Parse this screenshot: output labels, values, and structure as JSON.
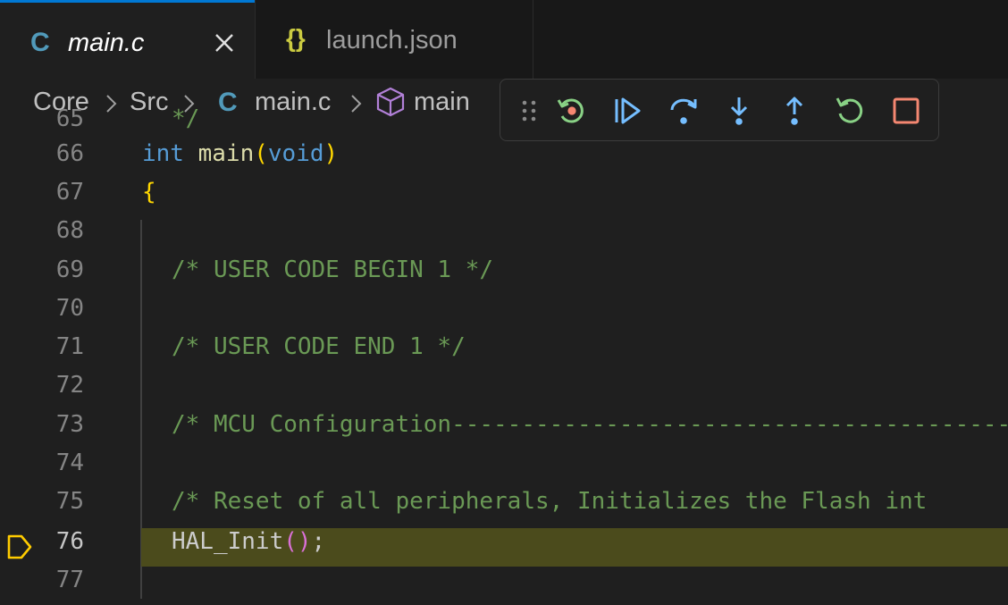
{
  "tabs": [
    {
      "label": "main.c",
      "icon": "c-file-icon",
      "active": true
    },
    {
      "label": "launch.json",
      "icon": "json-file-icon",
      "active": false
    }
  ],
  "breadcrumb": {
    "items": [
      "Core",
      "Src",
      "main.c",
      "main"
    ],
    "c_glyph": "C",
    "json_glyph": "{}"
  },
  "debug_toolbar": {
    "buttons": [
      "drag-handle",
      "restart-frame",
      "continue",
      "step-over",
      "step-into",
      "step-out",
      "restart",
      "stop"
    ]
  },
  "colors": {
    "accent": "#0078d4",
    "highlight_line": "#4b4b1c",
    "breakpoint_arrow": "#ffcc00"
  },
  "editor": {
    "partial_top_line_number": "65",
    "partial_top_text": "*/",
    "lines": [
      {
        "num": "66",
        "text": "int main(void)"
      },
      {
        "num": "67",
        "text": "{"
      },
      {
        "num": "68",
        "text": ""
      },
      {
        "num": "69",
        "text": "/* USER CODE BEGIN 1 */"
      },
      {
        "num": "70",
        "text": ""
      },
      {
        "num": "71",
        "text": "/* USER CODE END 1 */"
      },
      {
        "num": "72",
        "text": ""
      },
      {
        "num": "73",
        "text": "/* MCU Configuration----------------------------------------"
      },
      {
        "num": "74",
        "text": ""
      },
      {
        "num": "75",
        "text": "/* Reset of all peripherals, Initializes the Flash int"
      },
      {
        "num": "76",
        "text": "HAL_Init();",
        "current": true
      },
      {
        "num": "77",
        "text": ""
      }
    ],
    "tokens": {
      "kw_int": "int",
      "fn_main": "main",
      "paren_open": "(",
      "kw_void": "void",
      "paren_close": ")",
      "brace": "{",
      "fn_hal": "HAL_Init",
      "paren2_open": "(",
      "paren2_close": ")",
      "semicolon": ";"
    }
  }
}
